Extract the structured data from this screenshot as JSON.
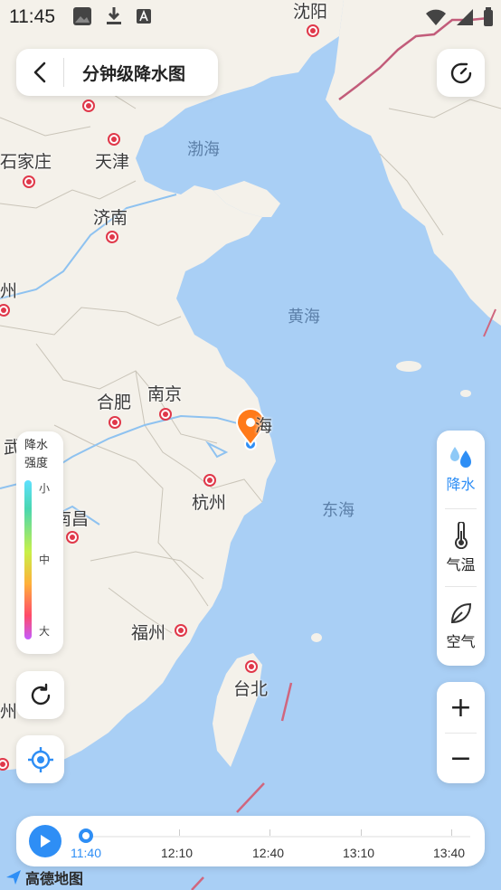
{
  "status_bar": {
    "time": "11:45"
  },
  "header": {
    "title": "分钟级降水图"
  },
  "map": {
    "cities": [
      "沈阳",
      "石家庄",
      "天津",
      "济南",
      "州",
      "合肥",
      "南京",
      "杭州",
      "南昌",
      "福州",
      "台北",
      "海",
      "武",
      "州"
    ],
    "seas": [
      "渤海",
      "黄海",
      "东海"
    ]
  },
  "legend": {
    "title_line1": "降水",
    "title_line2": "强度",
    "low": "小",
    "mid": "中",
    "high": "大"
  },
  "layers": [
    {
      "label": "降水",
      "icon": "raindrops-icon",
      "active": true
    },
    {
      "label": "气温",
      "icon": "thermometer-icon",
      "active": false
    },
    {
      "label": "空气",
      "icon": "leaf-icon",
      "active": false
    }
  ],
  "zoom": {
    "in": "+",
    "out": "−"
  },
  "timeline": {
    "labels": [
      "11:40",
      "12:10",
      "12:40",
      "13:10",
      "13:40"
    ],
    "current": "11:40"
  },
  "brand": {
    "logo_text": "高德地图"
  },
  "colors": {
    "accent": "#2e8ef5",
    "sea": "#a9cff5",
    "land": "#f4f1ea",
    "marker": "#ff7a1a"
  }
}
